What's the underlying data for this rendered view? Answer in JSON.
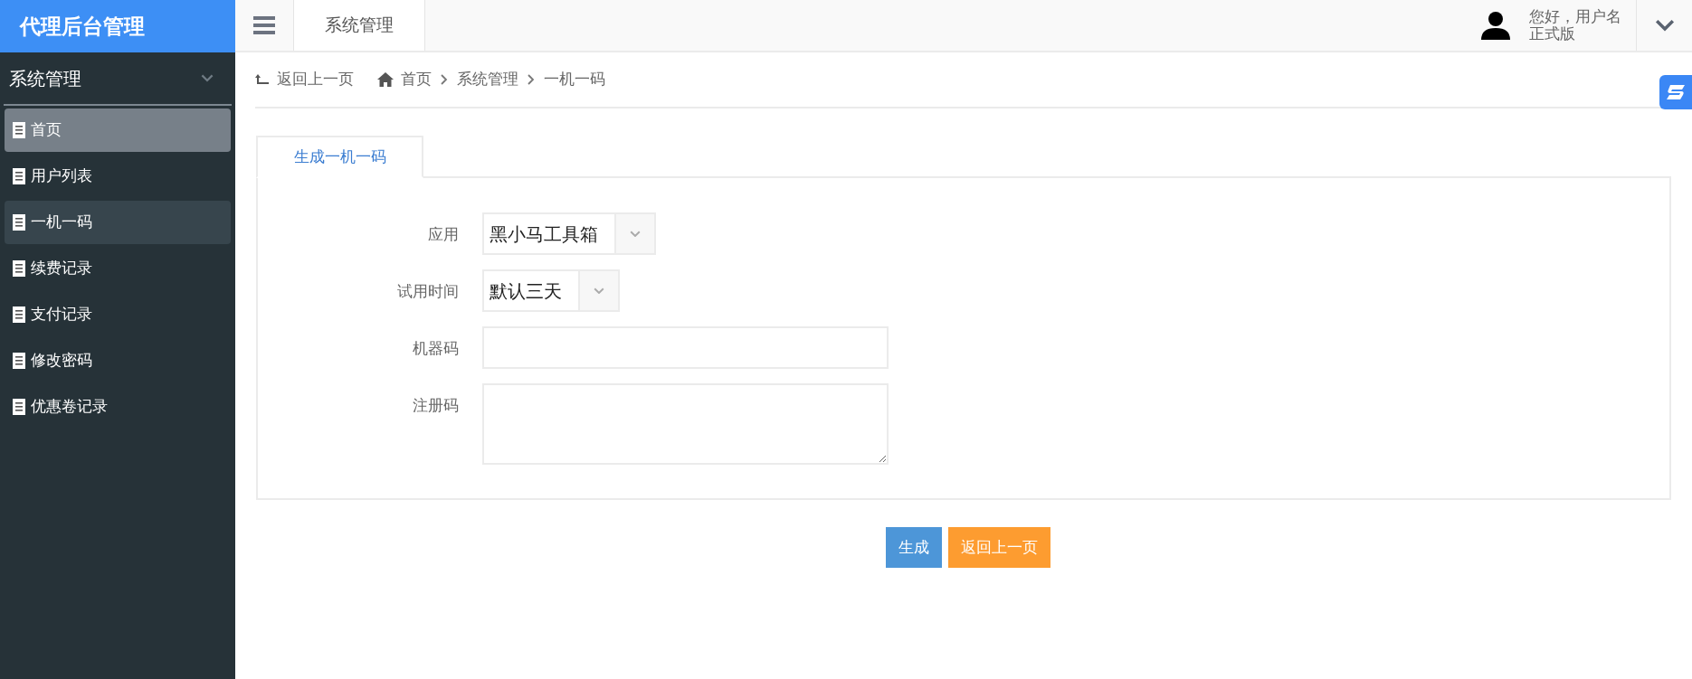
{
  "brand": "代理后台管理",
  "topbar": {
    "tab": "系统管理",
    "greeting": "您好，用户名",
    "edition": "正式版"
  },
  "sidebar": {
    "section": "系统管理",
    "expanded": true,
    "items": [
      {
        "label": "首页",
        "selected": true,
        "hovered": false
      },
      {
        "label": "用户列表",
        "selected": false,
        "hovered": false
      },
      {
        "label": "一机一码",
        "selected": false,
        "hovered": true
      },
      {
        "label": "续费记录",
        "selected": false,
        "hovered": false
      },
      {
        "label": "支付记录",
        "selected": false,
        "hovered": false
      },
      {
        "label": "修改密码",
        "selected": false,
        "hovered": false
      },
      {
        "label": "优惠卷记录",
        "selected": false,
        "hovered": false
      }
    ]
  },
  "breadcrumb": {
    "back": "返回上一页",
    "items": [
      "首页",
      "系统管理",
      "一机一码"
    ]
  },
  "tabs": [
    {
      "label": "生成一机一码",
      "selected": true
    }
  ],
  "form": [
    {
      "kind": "select",
      "label": "应用",
      "value": "黑小马工具箱"
    },
    {
      "kind": "select",
      "label": "试用时间",
      "value": "默认三天"
    },
    {
      "kind": "input",
      "label": "机器码"
    },
    {
      "kind": "textarea",
      "label": "注册码"
    }
  ],
  "buttons": [
    {
      "label": "生成",
      "kind": "primary"
    },
    {
      "label": "返回上一页",
      "kind": "warning"
    }
  ]
}
